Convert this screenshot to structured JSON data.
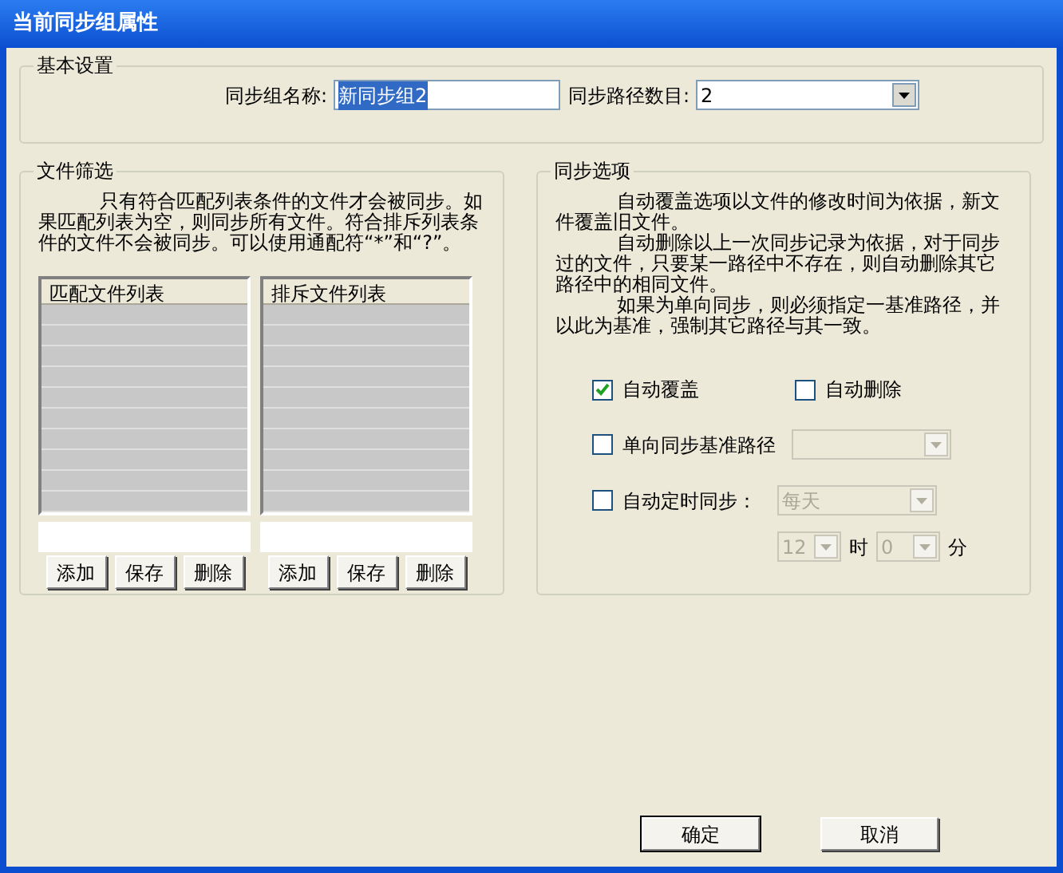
{
  "window": {
    "title": "当前同步组属性"
  },
  "basic": {
    "legend": "基本设置",
    "name_label": "同步组名称:",
    "name_value": "新同步组2",
    "name_text_selected": true,
    "count_label": "同步路径数目:",
    "count_value": "2"
  },
  "filter": {
    "legend": "文件筛选",
    "description": "只有符合匹配列表条件的文件才会被同步。如果匹配列表为空，则同步所有文件。符合排斥列表条件的文件不会被同步。可以使用通配符“*”和“?”。",
    "lists": [
      {
        "header": "匹配文件列表",
        "buttons": [
          "添加",
          "保存",
          "删除"
        ]
      },
      {
        "header": "排斥文件列表",
        "buttons": [
          "添加",
          "保存",
          "删除"
        ]
      }
    ]
  },
  "options": {
    "legend": "同步选项",
    "paragraphs": [
      "自动覆盖选项以文件的修改时间为依据，新文件覆盖旧文件。",
      "自动删除以上一次同步记录为依据，对于同步过的文件，只要某一路径中不存在，则自动删除其它路径中的相同文件。",
      "如果为单向同步，则必须指定一基准路径，并以此为基准，强制其它路径与其一致。"
    ],
    "checks": [
      {
        "label": "自动覆盖",
        "checked": true
      },
      {
        "label": "自动删除",
        "checked": false
      }
    ],
    "base_path": {
      "label": "单向同步基准路径",
      "checked": false,
      "disabled": true
    },
    "timer": {
      "label": "自动定时同步：",
      "checked": false,
      "disabled": true,
      "period": "每天",
      "hour": "12",
      "hour_unit": "时",
      "minute": "0",
      "minute_unit": "分"
    }
  },
  "footer": [
    {
      "label": "确定",
      "default": true
    },
    {
      "label": "取消",
      "default": false
    }
  ]
}
